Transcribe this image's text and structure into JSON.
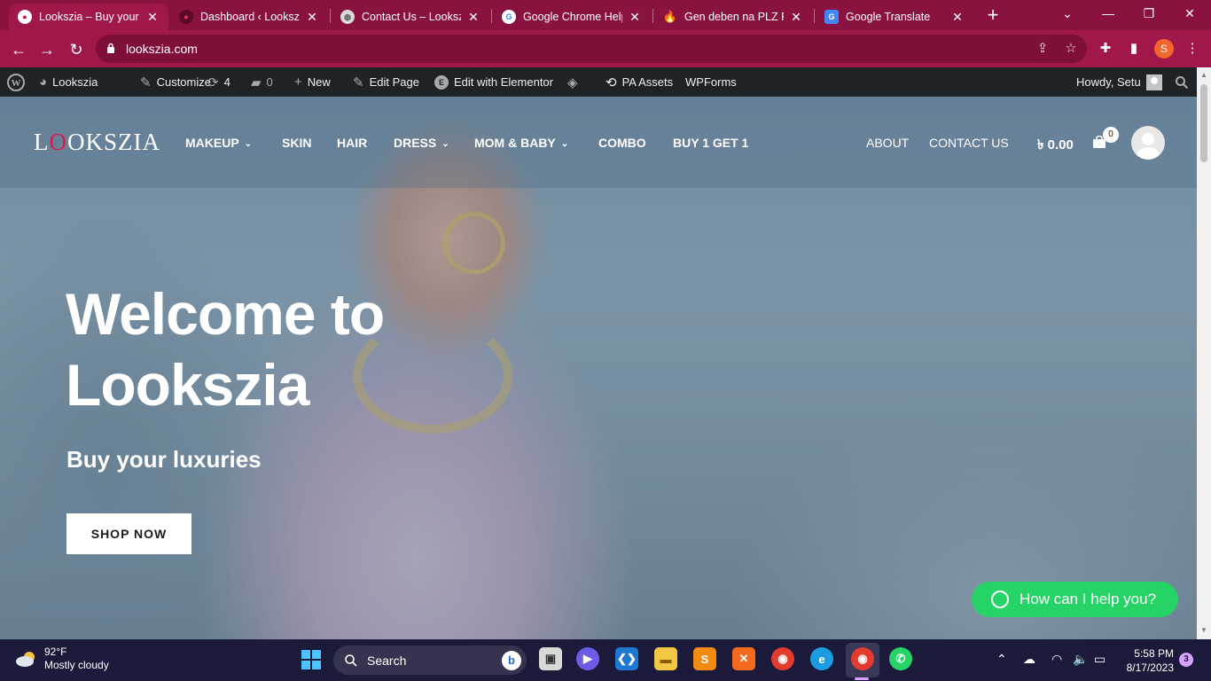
{
  "browser": {
    "tabs": [
      {
        "title": "Lookszia – Buy your lu",
        "favicon": "lookszia-logo-icon",
        "active": true
      },
      {
        "title": "Dashboard ‹ Lookszia",
        "favicon": "lookszia-logo-icon",
        "active": false
      },
      {
        "title": "Contact Us – Lookszia",
        "favicon": "globe-icon",
        "active": false
      },
      {
        "title": "Google Chrome Help",
        "favicon": "google-icon",
        "active": false
      },
      {
        "title": "Gen deben na PLZ Pri",
        "favicon": "fire-icon",
        "active": false
      },
      {
        "title": "Google Translate",
        "favicon": "google-translate-icon",
        "active": false
      }
    ],
    "url": "lookszia.com",
    "profile_initial": "S",
    "accent": "#a0174c"
  },
  "adminbar": {
    "site_name": "Lookszia",
    "customize": "Customize",
    "updates_count": "4",
    "comments_count": "0",
    "new_label": "New",
    "edit_page": "Edit Page",
    "edit_elementor": "Edit with Elementor",
    "pa_assets": "PA Assets",
    "wpforms": "WPForms",
    "howdy": "Howdy, Setu"
  },
  "site": {
    "logo": {
      "before": "L",
      "o": "O",
      "after": "OKSZIA"
    },
    "menu": [
      {
        "label": "MAKEUP",
        "dropdown": true
      },
      {
        "label": "SKIN",
        "dropdown": false
      },
      {
        "label": "HAIR",
        "dropdown": false
      },
      {
        "label": "DRESS",
        "dropdown": true
      },
      {
        "label": "MOM & BABY",
        "dropdown": true
      },
      {
        "label": "COMBO",
        "dropdown": false
      },
      {
        "label": "BUY 1 GET 1",
        "dropdown": false
      }
    ],
    "secondary_menu": [
      "ABOUT",
      "CONTACT US"
    ],
    "cart_total": "৳ 0.00",
    "cart_count": "0"
  },
  "hero": {
    "title_line1": "Welcome to",
    "title_line2": "Lookszia",
    "subtitle": "Buy your luxuries",
    "cta": "SHOP NOW",
    "whatsapp": "How can I help you?",
    "whatsapp_color": "#25d366"
  },
  "taskbar": {
    "temperature": "92°F",
    "weather": "Mostly cloudy",
    "search_label": "Search",
    "time": "5:58 PM",
    "date": "8/17/2023",
    "notification_count": "3"
  }
}
